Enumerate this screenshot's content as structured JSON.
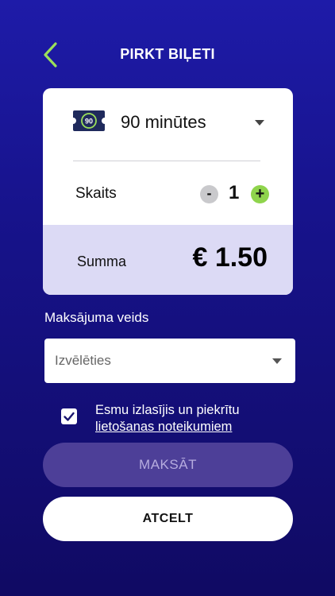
{
  "header": {
    "title": "PIRKT BIĻETI",
    "back_icon": "chevron-left-icon",
    "accent_color": "#9be05a"
  },
  "ticket": {
    "icon": "ticket-90-icon",
    "icon_text": "90",
    "label": "90 minūtes"
  },
  "quantity": {
    "label": "Skaits",
    "minus_label": "-",
    "value": "1",
    "plus_label": "+"
  },
  "total": {
    "label": "Summa",
    "value": "€ 1.50"
  },
  "payment": {
    "label": "Maksājuma veids",
    "placeholder": "Izvēlēties"
  },
  "terms": {
    "checked": true,
    "text": "Esmu izlasījis un piekrītu",
    "link": "lietošanas noteikumiem"
  },
  "buttons": {
    "pay": "MAKSĀT",
    "cancel": "ATCELT"
  }
}
